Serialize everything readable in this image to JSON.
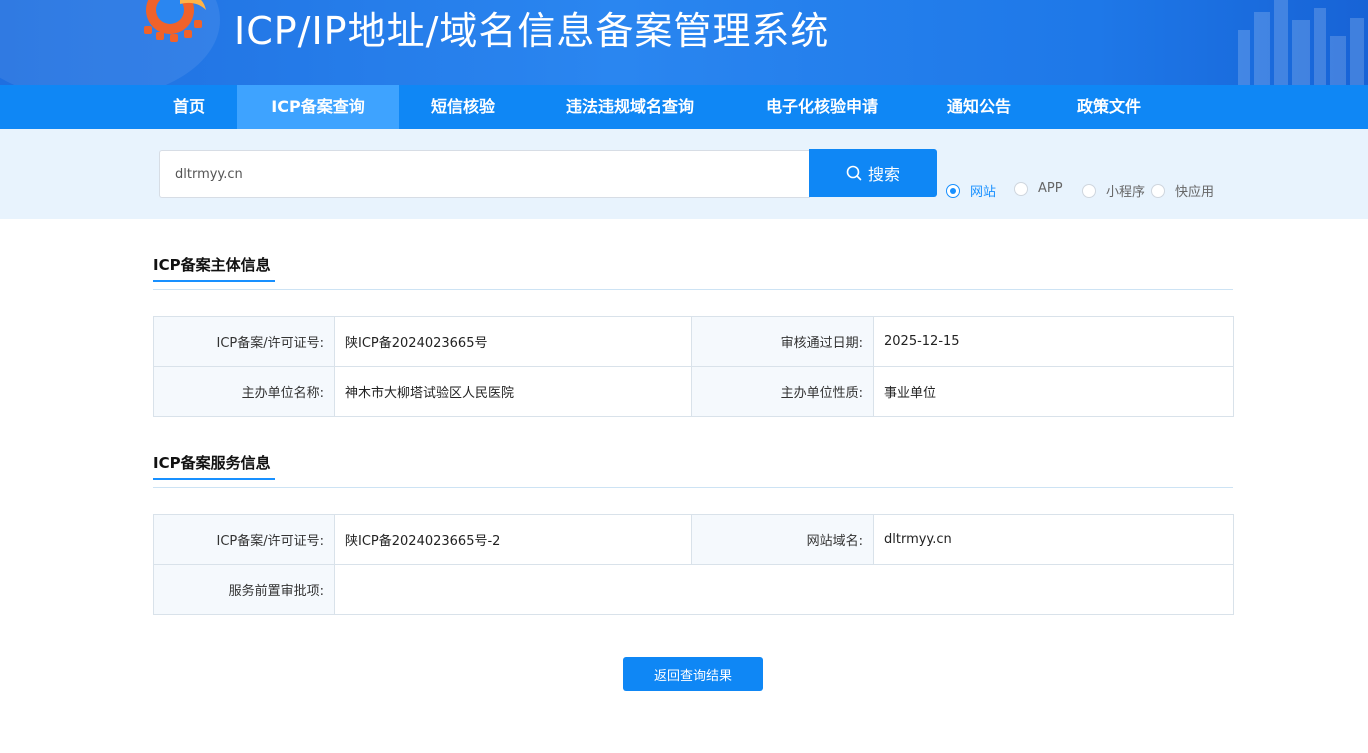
{
  "header": {
    "title": "ICP/IP地址/域名信息备案管理系统"
  },
  "nav": {
    "items": [
      {
        "label": "首页",
        "active": false
      },
      {
        "label": "ICP备案查询",
        "active": true
      },
      {
        "label": "短信核验",
        "active": false
      },
      {
        "label": "违法违规域名查询",
        "active": false
      },
      {
        "label": "电子化核验申请",
        "active": false
      },
      {
        "label": "通知公告",
        "active": false
      },
      {
        "label": "政策文件",
        "active": false
      }
    ]
  },
  "search": {
    "value": "dltrmyy.cn",
    "button_label": "搜索",
    "types": [
      {
        "label": "网站",
        "checked": true
      },
      {
        "label": "APP",
        "checked": false
      },
      {
        "label": "小程序",
        "checked": false
      },
      {
        "label": "快应用",
        "checked": false
      }
    ]
  },
  "subject_info": {
    "title": "ICP备案主体信息",
    "license_label": "ICP备案/许可证号:",
    "license_value": "陕ICP备2024023665号",
    "approve_date_label": "审核通过日期:",
    "approve_date_value": "2025-12-15",
    "org_name_label": "主办单位名称:",
    "org_name_value": "神木市大柳塔试验区人民医院",
    "org_type_label": "主办单位性质:",
    "org_type_value": "事业单位"
  },
  "service_info": {
    "title": "ICP备案服务信息",
    "license_label": "ICP备案/许可证号:",
    "license_value": "陕ICP备2024023665号-2",
    "domain_label": "网站域名:",
    "domain_value": "dltrmyy.cn",
    "pre_approval_label": "服务前置审批项:",
    "pre_approval_value": ""
  },
  "return_button_label": "返回查询结果",
  "colors": {
    "brand_blue": "#0f87f5",
    "nav_active": "#3ea3ff",
    "search_band": "#e8f3fd",
    "accent": "#1890ff"
  }
}
